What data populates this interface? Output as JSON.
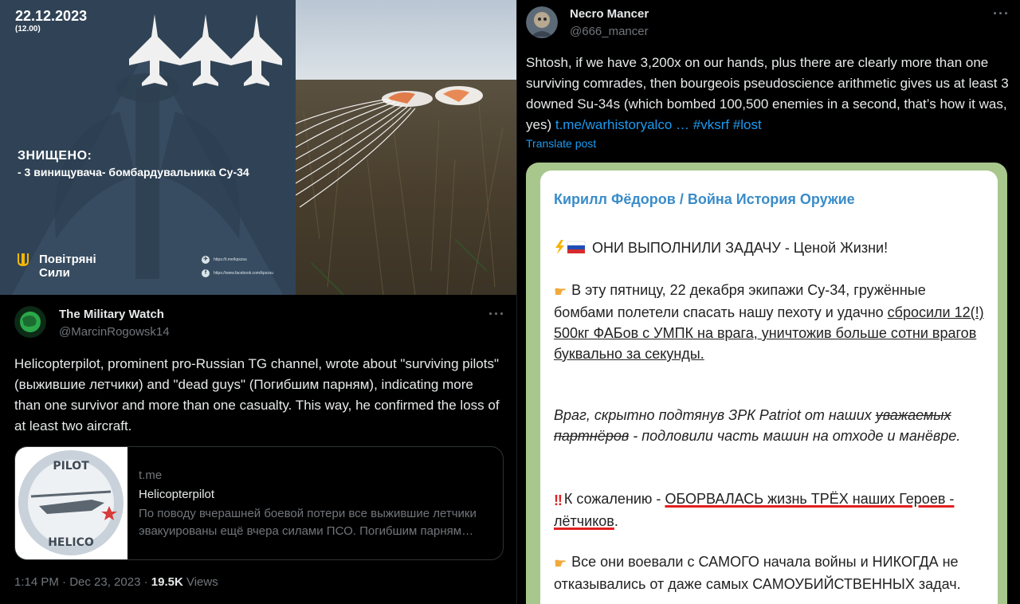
{
  "infographic": {
    "date": "22.12.2023",
    "time": "(12.00)",
    "heading": "ЗНИЩЕНО:",
    "item": "- 3 винищувача- бомбардувальника Су-34",
    "air_force_line1": "Повітряні",
    "air_force_line2": "Сили",
    "telegram_link": "https://t.me/kpszsu",
    "facebook_link": "https://www.facebook.com/kpszsu"
  },
  "tweet_left": {
    "name": "The Military Watch",
    "handle": "@MarcinRogowsk14",
    "body": "Helicopterpilot, prominent pro-Russian TG channel, wrote about \"surviving pilots\" (выжившие летчики) and \"dead guys\" (Погибшим парням), indicating more than one survivor and more than one casualty. This way, he confirmed the loss of at least two aircraft.",
    "card": {
      "domain": "t.me",
      "title": "Helicopterpilot",
      "description": "По поводу вчерашней боевой потери все выжившие летчики эвакуированы ещё вчера силами ПСО. Погибшим парням вечная память!",
      "thumb_text": "HELICOPTERPILOT"
    },
    "time": "1:14 PM · Dec 23, 2023 · ",
    "views_count": "19.5K",
    "views_label": " Views"
  },
  "tweet_right": {
    "name": "Necro Mancer",
    "handle": "@666_mancer",
    "body_text": "Shtosh, if we have 3,200x on our hands, plus there are clearly more than one surviving comrades, then bourgeois pseudoscience arithmetic gives us at least 3 downed Su-34s (which bombed 100,500 enemies in a second, that’s how it was, yes) ",
    "link_text": "t.me/warhistoryalco …",
    "hashtag1": " #vksrf",
    "hashtag2": " #lost",
    "translate": "Translate post",
    "telegram_post": {
      "channel": "Кирилл Фёдоров / Война История Оружие",
      "p1": "ОНИ ВЫПОЛНИЛИ ЗАДАЧУ - Ценой Жизни!",
      "p2_a": "В эту пятницу, 22 декабря экипажи Су-34, гружённые бомбами полетели спасать нашу пехоту и удачно ",
      "p2_b": "сбросили 12(!) 500кг ФАБов с УМПК на врага, уничтожив больше сотни врагов буквально за секунды.",
      "p3_a": "Враг, скрытно подтянув ЗРК Patriot от наших ",
      "p3_b": "уважаемых партнёров",
      "p3_c": " - подловили часть машин на отходе и манёвре.",
      "p4_a": "К сожалению - ",
      "p4_b": "ОБОРВАЛАСЬ жизнь ТРЁХ наших Героев - лётчиков",
      "p4_c": ".",
      "p5": "Все они воевали с САМОГО начала войны и НИКОГДА не отказывались от даже самых САМОУБИЙСТВЕННЫХ задач."
    }
  }
}
